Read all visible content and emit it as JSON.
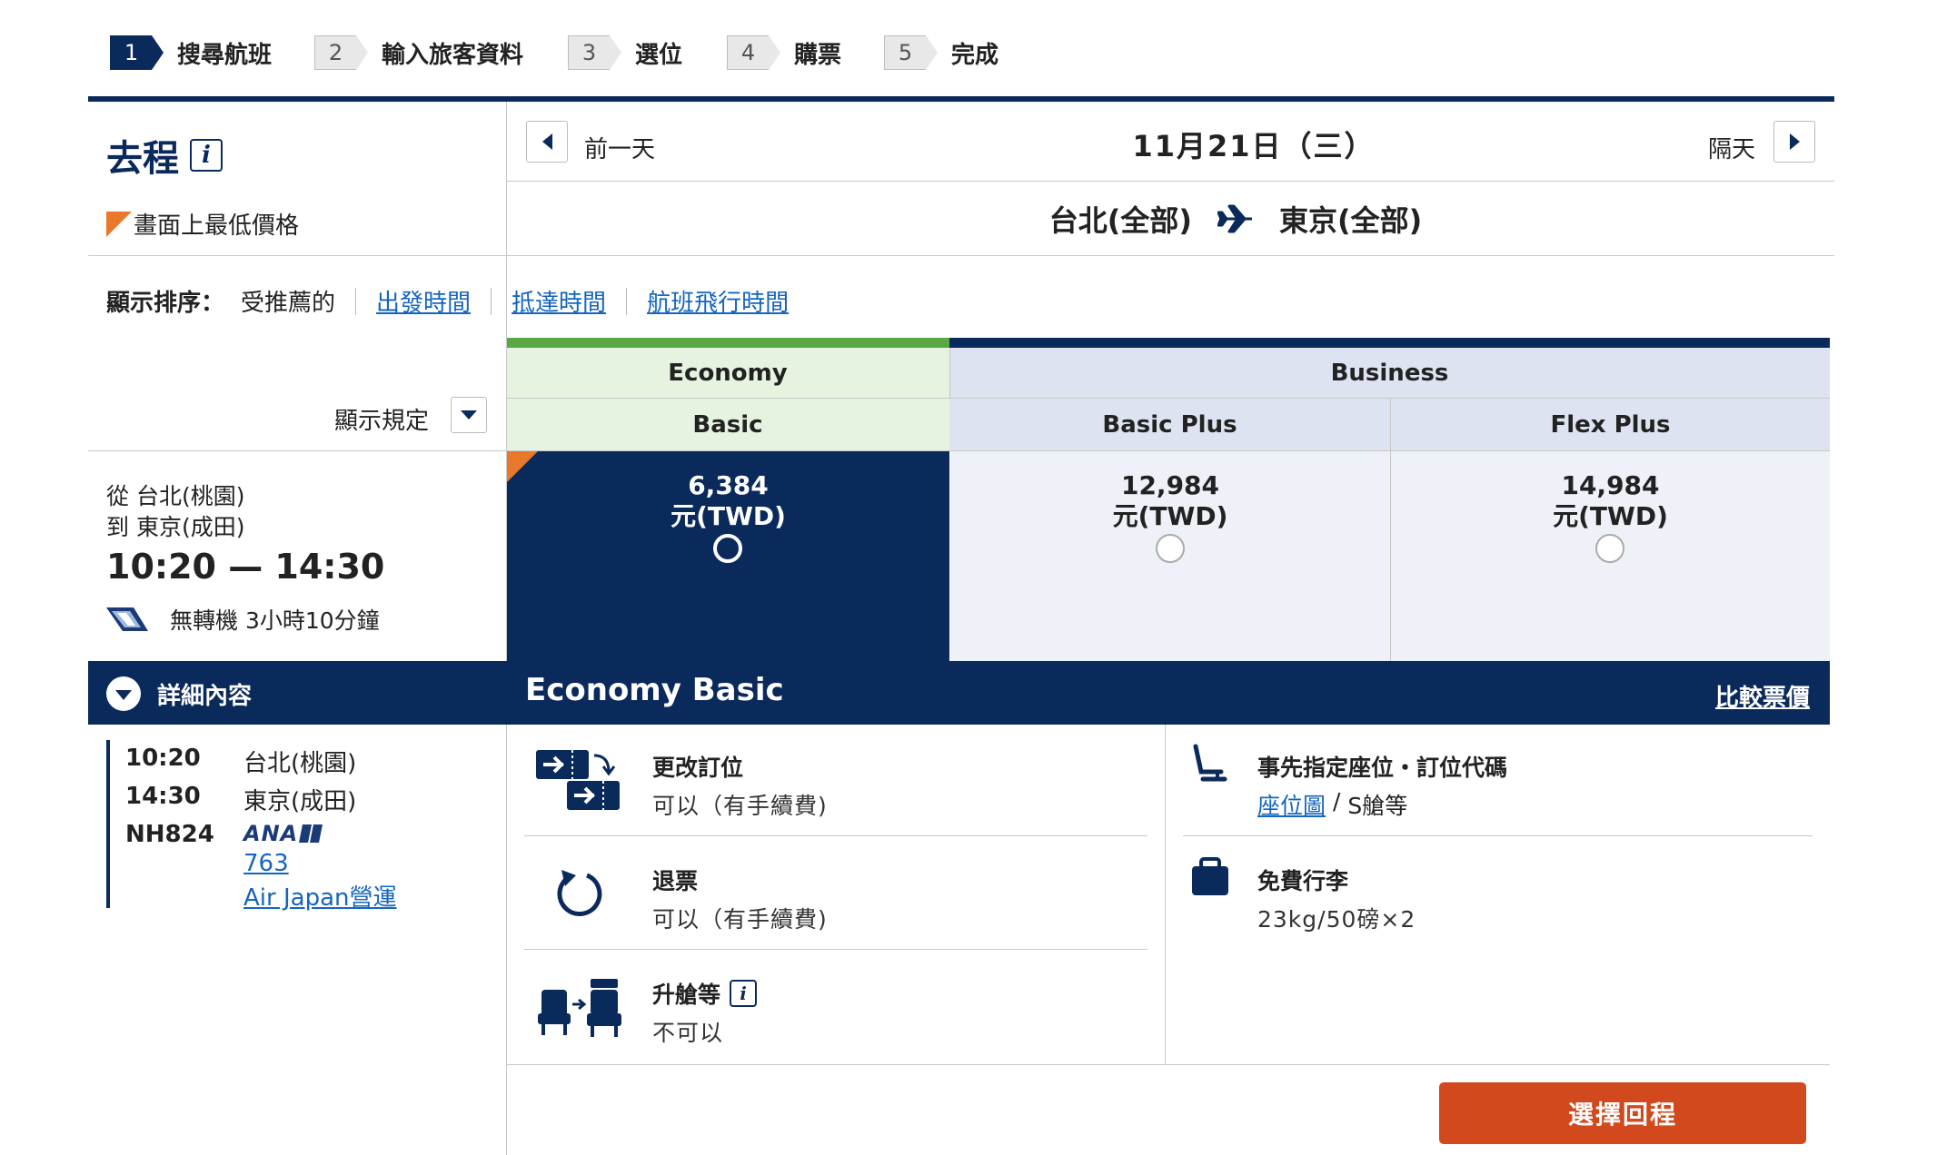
{
  "steps": [
    {
      "num": "1",
      "label": "搜尋航班"
    },
    {
      "num": "2",
      "label": "輸入旅客資料"
    },
    {
      "num": "3",
      "label": "選位"
    },
    {
      "num": "4",
      "label": "購票"
    },
    {
      "num": "5",
      "label": "完成"
    }
  ],
  "section": {
    "title": "去程",
    "lowest_price_legend": "畫面上最低價格"
  },
  "date_nav": {
    "prev_label": "前一天",
    "current_date": "11月21日（三）",
    "next_label": "隔天"
  },
  "route": {
    "origin": "台北(全部)",
    "destination": "東京(全部)"
  },
  "sort": {
    "label": "顯示排序：",
    "current": "受推薦的",
    "options": [
      "出發時間",
      "抵達時間",
      "航班飛行時間"
    ]
  },
  "display_rules_label": "顯示規定",
  "cabins": [
    {
      "name": "Economy",
      "fares": [
        "Basic"
      ]
    },
    {
      "name": "Business",
      "fares": [
        "Basic Plus",
        "Flex Plus"
      ]
    }
  ],
  "flight": {
    "from": "從 台北(桃園)",
    "to": "到 東京(成田)",
    "times": "10:20 — 14:30",
    "stops_duration": "無轉機 3小時10分鐘",
    "details_label": "詳細內容",
    "detail": {
      "dep_time": "10:20",
      "dep_airport": "台北(桃園)",
      "arr_time": "14:30",
      "arr_airport": "東京(成田)",
      "flight_no": "NH824",
      "airline_logo_text": "ANA",
      "aircraft": "763",
      "operator": "Air Japan營運"
    }
  },
  "prices": [
    {
      "amount": "6,384",
      "currency": "元(TWD)",
      "selected": true
    },
    {
      "amount": "12,984",
      "currency": "元(TWD)",
      "selected": false
    },
    {
      "amount": "14,984",
      "currency": "元(TWD)",
      "selected": false
    }
  ],
  "selected_fare": {
    "title_cabin": "Economy",
    "title_fare": "Basic",
    "compare_link": "比較票價",
    "features": {
      "change": {
        "title": "更改訂位",
        "value": "可以（有手續費)"
      },
      "refund": {
        "title": "退票",
        "value": "可以（有手續費)"
      },
      "upgrade": {
        "title": "升艙等",
        "value": "不可以"
      },
      "seat": {
        "title": "事先指定座位・訂位代碼",
        "link": "座位圖",
        "sep": " / ",
        "value": "S艙等"
      },
      "baggage": {
        "title": "免費行李",
        "value": "23kg/50磅×2"
      }
    }
  },
  "select_return_button": "選擇回程",
  "colors": {
    "navy": "#0b2a5c",
    "economy_green": "#5aa845",
    "economy_bg": "#e6f3e0",
    "business_bg": "#dde3f1",
    "accent_orange": "#e8782b",
    "button": "#d2491d"
  }
}
